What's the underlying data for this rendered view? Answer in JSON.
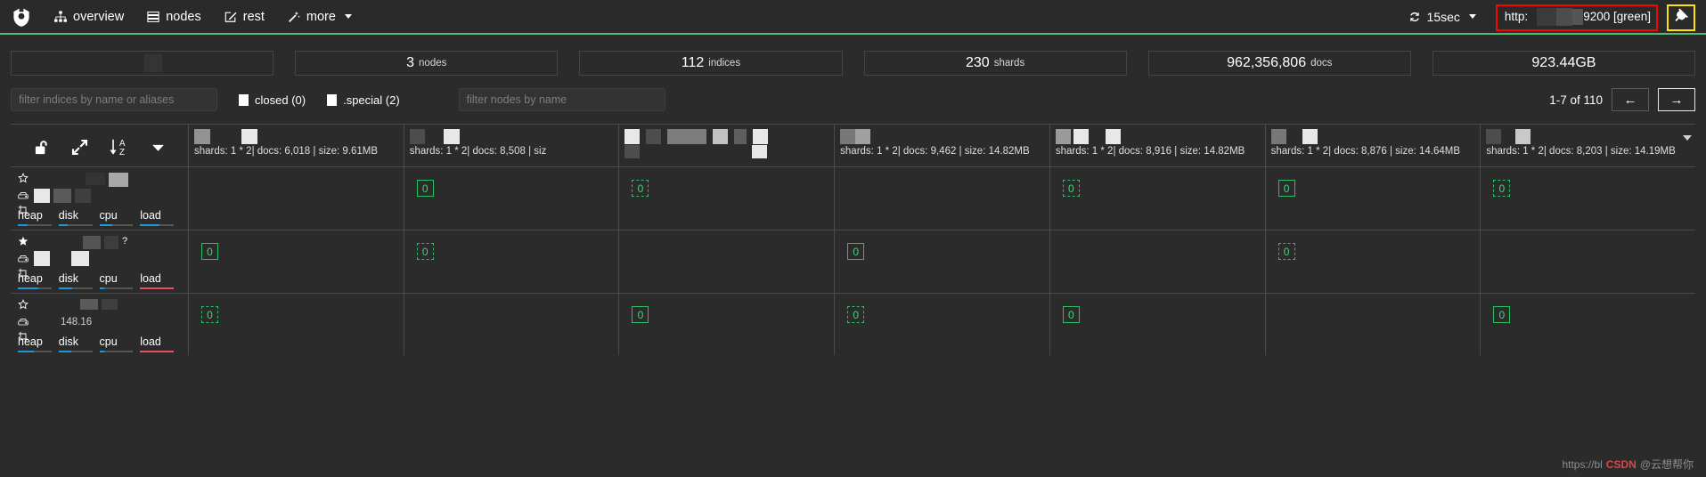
{
  "navbar": {
    "logo_icon": "cerebro-logo-icon",
    "items": [
      {
        "label": "overview",
        "icon": "sitemap-icon"
      },
      {
        "label": "nodes",
        "icon": "server-stack-icon"
      },
      {
        "label": "rest",
        "icon": "edit-square-icon"
      },
      {
        "label": "more",
        "icon": "magic-wand-icon",
        "has_caret": true
      }
    ],
    "refresh": {
      "label": "15sec",
      "icon": "refresh-icon",
      "has_caret": true
    },
    "connection": {
      "prefix": "http:",
      "suffix": "9200 [green]",
      "redacted": true,
      "annotation_color": "#ff0000"
    },
    "disconnect": {
      "icon": "plug-icon",
      "annotation_color": "#ffe400"
    },
    "accent_color": "#4bbf73"
  },
  "stats": [
    {
      "num": "",
      "unit": "",
      "redacted": true
    },
    {
      "num": "3",
      "unit": "nodes"
    },
    {
      "num": "112",
      "unit": "indices"
    },
    {
      "num": "230",
      "unit": "shards"
    },
    {
      "num": "962,356,806",
      "unit": "docs"
    },
    {
      "num": "923.44GB",
      "unit": ""
    }
  ],
  "filters": {
    "index_placeholder": "filter indices by name or aliases",
    "index_value": "",
    "closed_label": "closed (0)",
    "special_label": ".special (2)",
    "node_placeholder": "filter nodes by name",
    "node_value": ""
  },
  "pagination": {
    "label": "1-7 of 110",
    "prev": "←",
    "next": "→"
  },
  "table": {
    "toolbar": [
      {
        "icon": "unlock-icon",
        "name": "toggle-index-lock"
      },
      {
        "icon": "expand-arrows-icon",
        "name": "toggle-fullscreen"
      },
      {
        "icon": "sort-az-icon",
        "name": "sort-az"
      },
      {
        "icon": "chevron-down-icon",
        "name": "more-actions"
      }
    ],
    "columns": [
      {
        "name_redacted": true,
        "meta": "shards: 1 * 2| docs: 6,018 | size: 9.61MB"
      },
      {
        "name_redacted": true,
        "meta": "shards: 1 * 2| docs: 8,508 | siz"
      },
      {
        "name_redacted": true,
        "meta": ""
      },
      {
        "name_redacted": true,
        "meta": "shards: 1 * 2| docs: 9,462 | size: 14.82MB"
      },
      {
        "name_redacted": true,
        "meta": "shards: 1 * 2| docs: 8,916 | size: 14.82MB"
      },
      {
        "name_redacted": true,
        "meta": "shards: 1 * 2| docs: 8,876 | size: 14.64MB"
      },
      {
        "name_redacted": true,
        "meta": "shards: 1 * 2| docs: 8,203 | size: 14.19MB"
      }
    ],
    "nodes": [
      {
        "master": false,
        "name_redacted": true,
        "icons": [
          "star-outline-icon",
          "hdd-icon",
          "crop-icon"
        ],
        "metrics": [
          {
            "label": "heap",
            "pct": 30,
            "color": "#2196d6"
          },
          {
            "label": "disk",
            "pct": 28,
            "color": "#2196d6"
          },
          {
            "label": "cpu",
            "pct": 38,
            "color": "#2196d6"
          },
          {
            "label": "load",
            "pct": 58,
            "color": "#2196d6"
          }
        ],
        "shards": [
          "",
          "primary",
          "replica",
          "",
          "replica",
          "primary",
          "replica"
        ]
      },
      {
        "master": true,
        "name_redacted": true,
        "icons": [
          "star-filled-icon",
          "hdd-icon",
          "crop-icon"
        ],
        "metrics": [
          {
            "label": "heap",
            "pct": 60,
            "color": "#2196d6"
          },
          {
            "label": "disk",
            "pct": 40,
            "color": "#2196d6"
          },
          {
            "label": "cpu",
            "pct": 15,
            "color": "#2196d6"
          },
          {
            "label": "load",
            "pct": 100,
            "color": "#e4515f"
          }
        ],
        "shards": [
          "primary",
          "replica",
          "",
          "primary",
          "",
          "replica",
          ""
        ]
      },
      {
        "master": false,
        "name_redacted": true,
        "extra_text": "148.16",
        "icons": [
          "star-outline-icon",
          "hdd-icon",
          "crop-icon"
        ],
        "metrics": [
          {
            "label": "heap",
            "pct": 48,
            "color": "#2196d6"
          },
          {
            "label": "disk",
            "pct": 38,
            "color": "#2196d6"
          },
          {
            "label": "cpu",
            "pct": 15,
            "color": "#2196d6"
          },
          {
            "label": "load",
            "pct": 100,
            "color": "#e4515f"
          }
        ],
        "shards": [
          "replica",
          "",
          "primary",
          "replica",
          "primary",
          "",
          "primary"
        ]
      }
    ],
    "shard_label": "0"
  },
  "watermark": {
    "prefix": "https://bl",
    "badge": "CSDN",
    "suffix": "@云想帮你"
  }
}
